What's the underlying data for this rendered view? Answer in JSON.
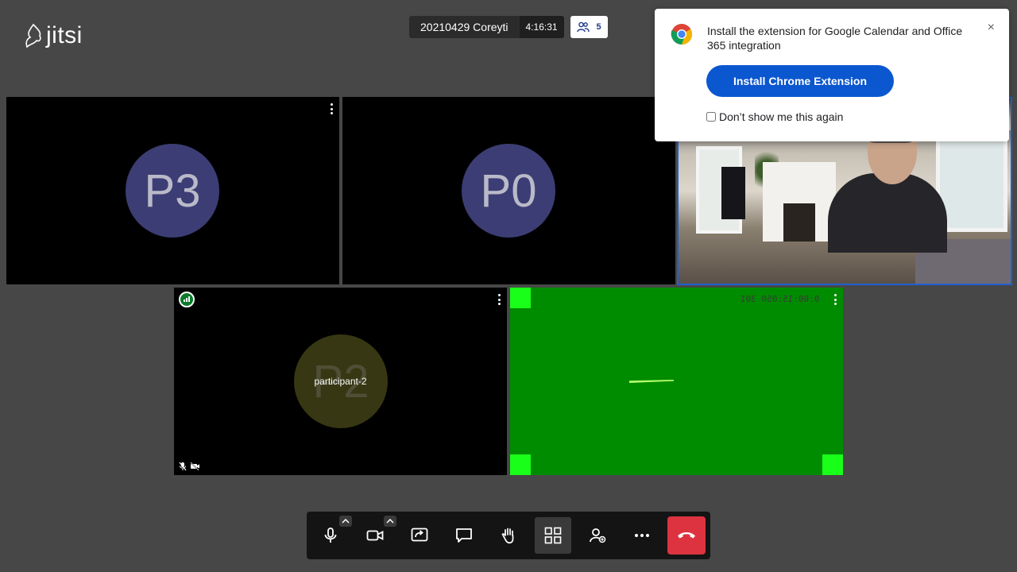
{
  "app": {
    "logo_text": "jitsi"
  },
  "meeting": {
    "subject": "20210429 Coreyti",
    "timer": "4:16:31",
    "participant_count": "5"
  },
  "tiles": {
    "p3": {
      "initials": "P3"
    },
    "p0": {
      "initials": "P0"
    },
    "p2": {
      "initials": "P2",
      "display_name": "participant-2"
    },
    "green": {
      "timestamp": "0:00:15:050 301"
    }
  },
  "notification": {
    "message": "Install the extension for Google Calendar and Office 365 integration",
    "install_label": "Install Chrome Extension",
    "dont_show_label": "Don’t show me this again",
    "close_glyph": "×"
  },
  "colors": {
    "accent": "#0b57d0",
    "hangup": "#dd3340",
    "active_speaker_border": "#1f5fd1",
    "avatar": "#3d3d75"
  },
  "toolbar": {
    "icons": [
      "microphone-icon",
      "camera-icon",
      "share-screen-icon",
      "chat-icon",
      "raise-hand-icon",
      "tile-view-icon",
      "invite-icon",
      "more-icon",
      "hangup-icon"
    ]
  }
}
